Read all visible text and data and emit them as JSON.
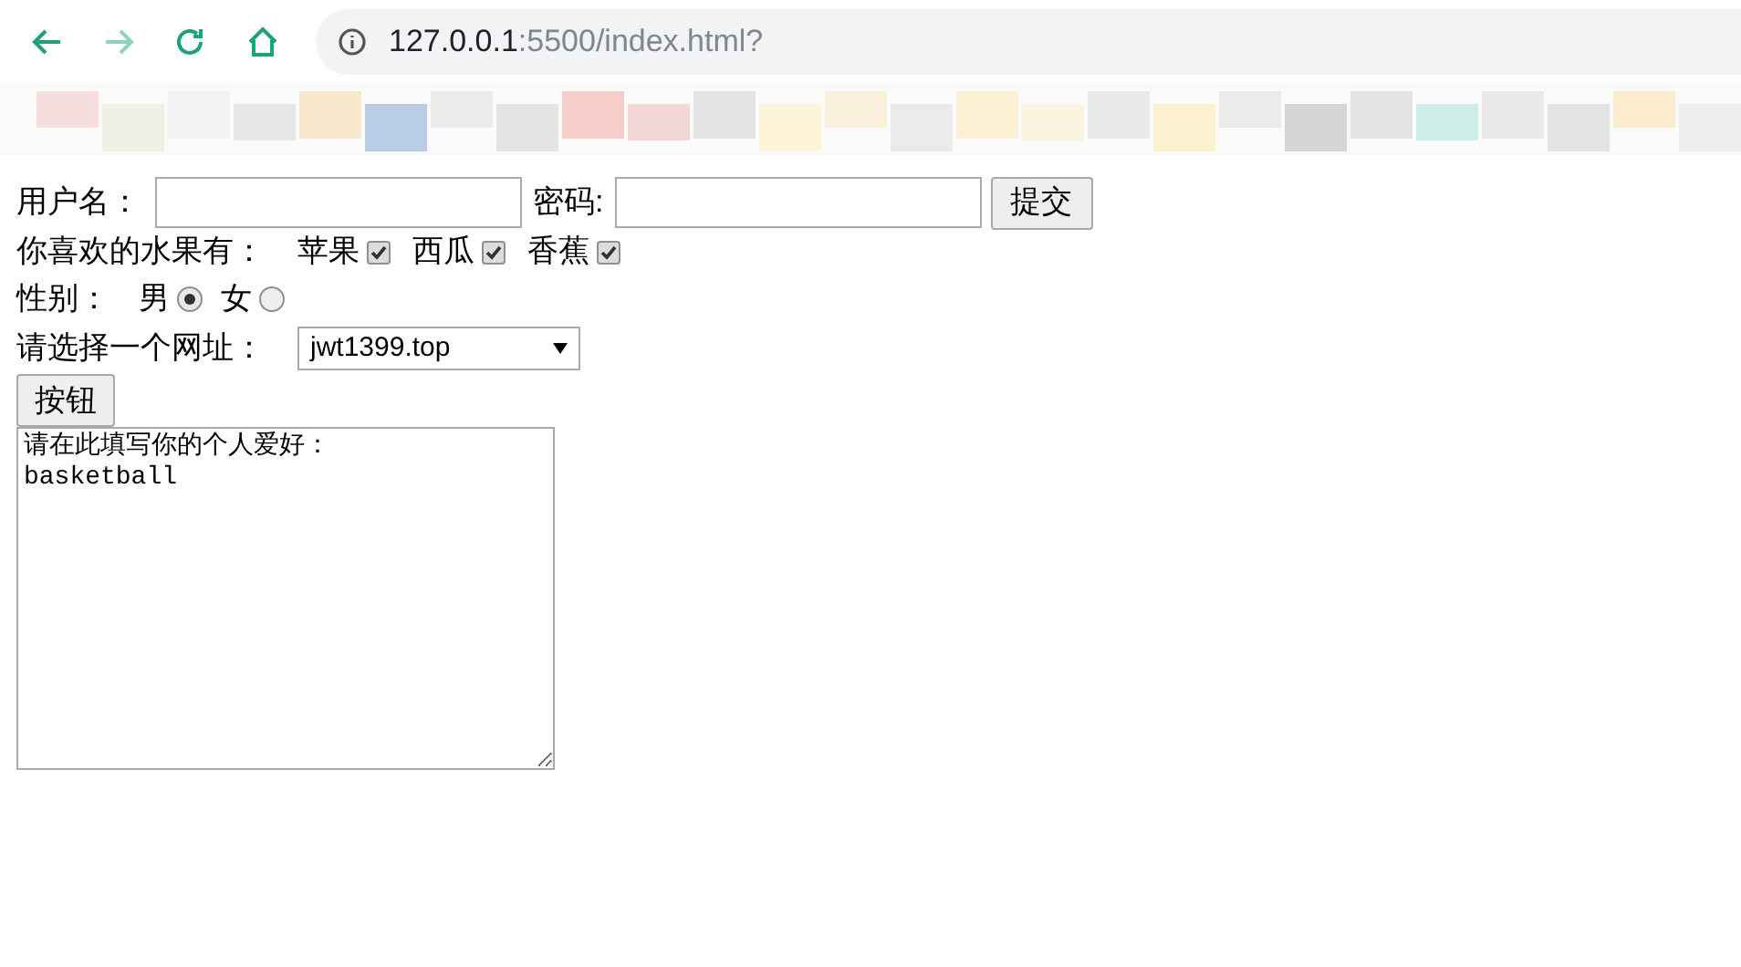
{
  "toolbar": {
    "address": {
      "host": "127.0.0.1",
      "path": ":5500/index.html?"
    }
  },
  "form": {
    "username": {
      "label": "用户名："
    },
    "password": {
      "label": "密码:"
    },
    "submit": "提交",
    "fruits": {
      "label": "你喜欢的水果有：",
      "options": [
        {
          "label": "苹果",
          "checked": true
        },
        {
          "label": "西瓜",
          "checked": true
        },
        {
          "label": "香蕉",
          "checked": true
        }
      ]
    },
    "gender": {
      "label": "性别：",
      "options": [
        {
          "label": "男",
          "selected": true
        },
        {
          "label": "女",
          "selected": false
        }
      ]
    },
    "site": {
      "label": "请选择一个网址：",
      "value": "jwt1399.top"
    },
    "button": "按钮",
    "hobby": {
      "value": "请在此填写你的个人爱好：\nbasketball"
    }
  }
}
